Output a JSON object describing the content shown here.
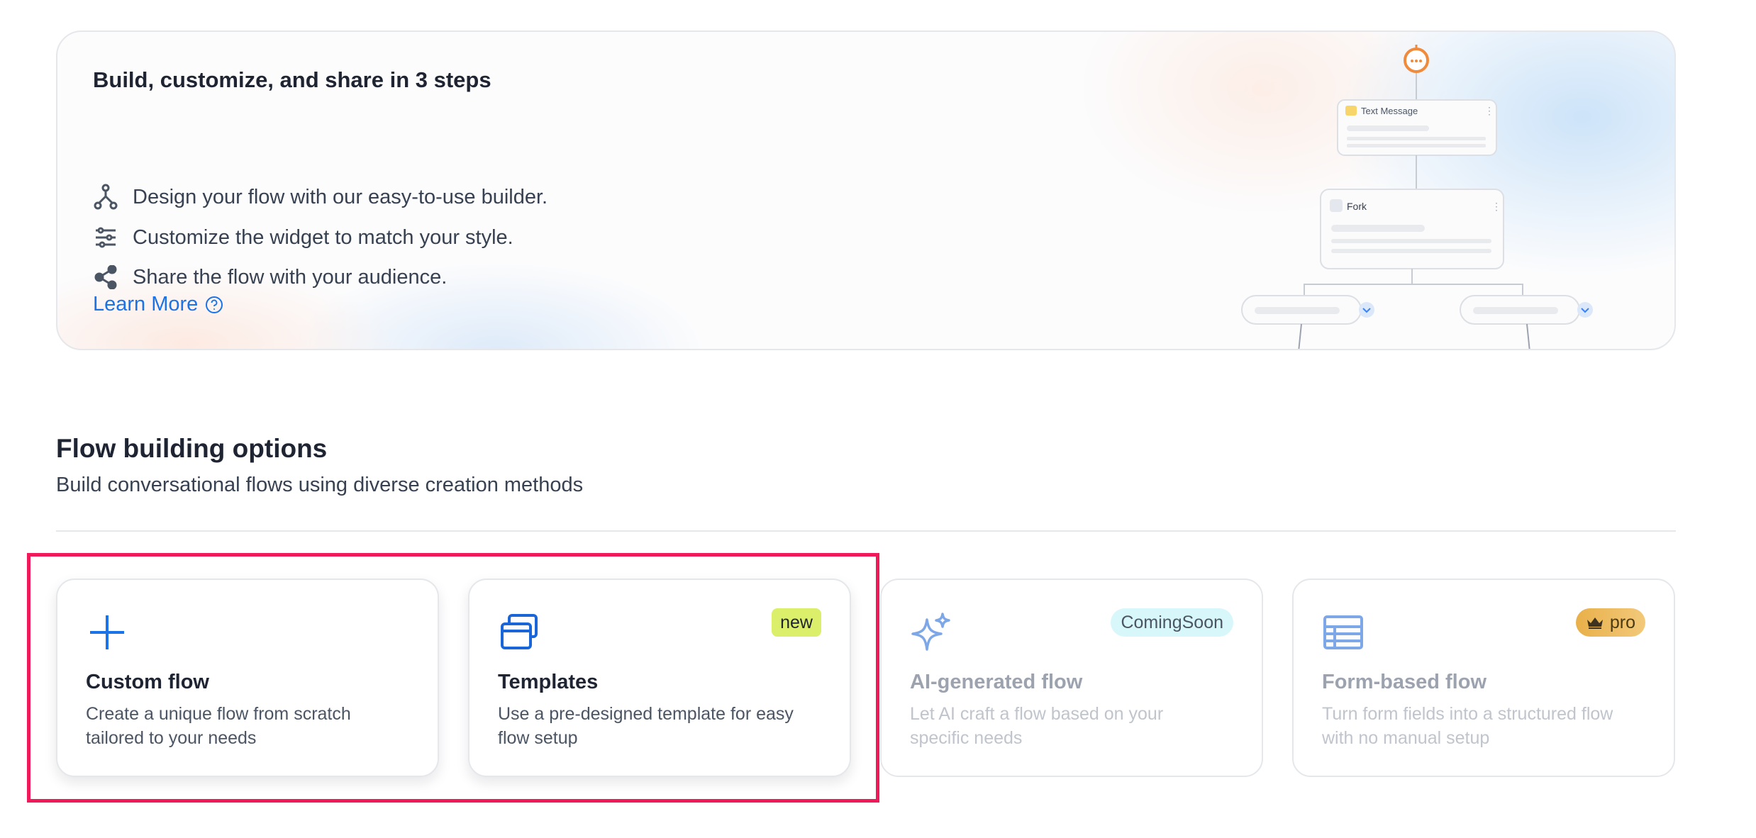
{
  "banner": {
    "title": "Build, customize, and share in 3 steps",
    "steps": [
      {
        "icon": "flow-builder-icon",
        "text": "Design your flow with our easy-to-use builder."
      },
      {
        "icon": "sliders-icon",
        "text": "Customize the widget to match your style."
      },
      {
        "icon": "share-icon",
        "text": "Share the flow with your audience."
      }
    ],
    "learn_more": "Learn More",
    "illustration": {
      "node1_label": "Text Message",
      "node2_label": "Fork"
    }
  },
  "section": {
    "title": "Flow building options",
    "subtitle": "Build conversational flows using diverse creation methods"
  },
  "cards": [
    {
      "title": "Custom flow",
      "desc": "Create a unique flow from scratch tailored to your needs",
      "icon": "plus-icon",
      "badge": ""
    },
    {
      "title": "Templates",
      "desc": "Use a pre-designed template for easy flow setup",
      "icon": "templates-icon",
      "badge": "new"
    },
    {
      "title": "AI-generated flow",
      "desc": "Let AI craft a flow based on your specific needs",
      "icon": "sparkle-icon",
      "badge": "ComingSoon"
    },
    {
      "title": "Form-based flow",
      "desc": "Turn form fields into a structured flow with no manual setup",
      "icon": "form-table-icon",
      "badge": "pro"
    }
  ],
  "colors": {
    "accent": "#1a73e8",
    "highlight": "#f0195a",
    "new_badge": "#dbef6a",
    "coming_soon_badge": "#d8f7fb",
    "pro_badge": "#e9b04a"
  }
}
